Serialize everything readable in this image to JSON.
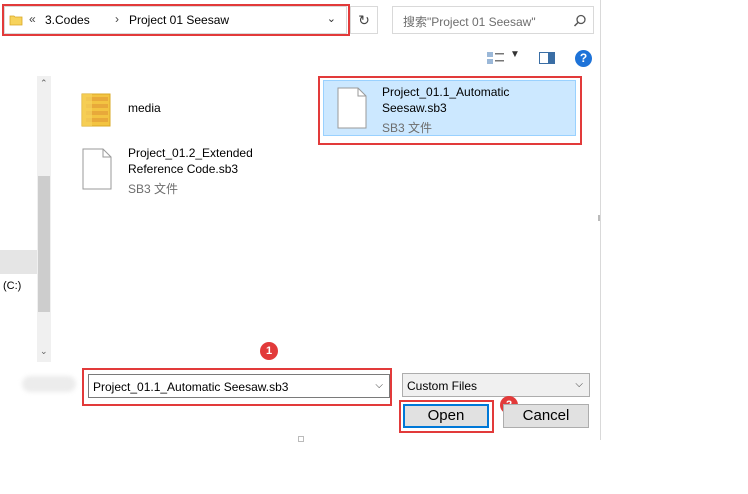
{
  "address_bar": {
    "overflow_chevron": "«",
    "crumbs": [
      "3.Codes",
      "Project 01 Seesaw"
    ],
    "separator": "›",
    "dropdown": "⌄"
  },
  "refresh_glyph": "↻",
  "search": {
    "placeholder": "搜索\"Project 01 Seesaw\"",
    "icon": "search-icon"
  },
  "toolbar": {
    "help": "?"
  },
  "nav": {
    "drive_label": "(C:)"
  },
  "files": [
    {
      "name": "media",
      "kind": "folder"
    },
    {
      "name": "Project_01.1_Automatic\nSeesaw.sb3",
      "type": "SB3 文件",
      "kind": "file",
      "selected": true
    },
    {
      "name": "Project_01.2_Extended\nReference Code.sb3",
      "type": "SB3 文件",
      "kind": "file"
    }
  ],
  "bottom": {
    "filename_value": "Project_01.1_Automatic Seesaw.sb3",
    "filter_value": "Custom Files",
    "open_label": "Open",
    "cancel_label": "Cancel"
  },
  "callouts": {
    "badge1": "1",
    "badge2": "2"
  },
  "colors": {
    "callout": "#e23a3a",
    "selection": "#cce8ff",
    "accent": "#0078d7"
  }
}
